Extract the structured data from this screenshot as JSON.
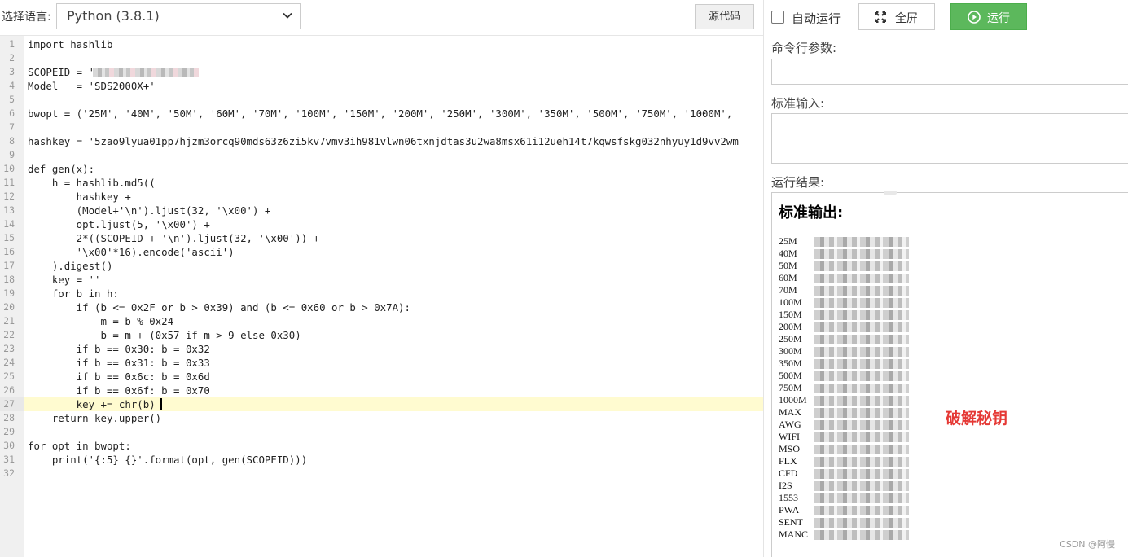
{
  "toolbar": {
    "lang_label": "选择语言:",
    "lang_selected": "Python (3.8.1)",
    "source_button": "源代码"
  },
  "editor": {
    "lines": [
      "import hashlib",
      "",
      "SCOPEID = '",
      "Model   = 'SDS2000X+'",
      "",
      "bwopt = ('25M', '40M', '50M', '60M', '70M', '100M', '150M', '200M', '250M', '300M', '350M', '500M', '750M', '1000M',",
      "",
      "hashkey = '5zao9lyua01pp7hjzm3orcq90mds63z6zi5kv7vmv3ih981vlwn06txnjdtas3u2wa8msx61i12ueh14t7kqwsfskg032nhyuy1d9vv2wm",
      "",
      "def gen(x):",
      "    h = hashlib.md5((",
      "        hashkey +",
      "        (Model+'\\n').ljust(32, '\\x00') +",
      "        opt.ljust(5, '\\x00') +",
      "        2*((SCOPEID + '\\n').ljust(32, '\\x00')) +",
      "        '\\x00'*16).encode('ascii')",
      "    ).digest()",
      "    key = ''",
      "    for b in h:",
      "        if (b <= 0x2F or b > 0x39) and (b <= 0x60 or b > 0x7A):",
      "            m = b % 0x24",
      "            b = m + (0x57 if m > 9 else 0x30)",
      "        if b == 0x30: b = 0x32",
      "        if b == 0x31: b = 0x33",
      "        if b == 0x6c: b = 0x6d",
      "        if b == 0x6f: b = 0x70",
      "        key += chr(b)",
      "    return key.upper()",
      "",
      "for opt in bwopt:",
      "    print('{:5} {}'.format(opt, gen(SCOPEID)))",
      ""
    ],
    "active_line": 27
  },
  "right": {
    "auto_run_label": "自动运行",
    "fullscreen_label": "全屏",
    "run_label": "运行",
    "args_label": "命令行参数:",
    "stdin_label": "标准输入:",
    "result_label": "运行结果:",
    "stdout_title": "标准输出:",
    "outputs": [
      "25M",
      "40M",
      "50M",
      "60M",
      "70M",
      "100M",
      "150M",
      "200M",
      "250M",
      "300M",
      "350M",
      "500M",
      "750M",
      "1000M",
      "MAX",
      "AWG",
      "WIFI",
      "MSO",
      "FLX",
      "CFD",
      "I2S",
      "1553",
      "PWA",
      "SENT",
      "MANC"
    ],
    "overlay_text": "破解秘钥",
    "watermark": "CSDN @阿慢",
    "run_color": "#5cb85c",
    "overlay_color": "#e53935"
  }
}
